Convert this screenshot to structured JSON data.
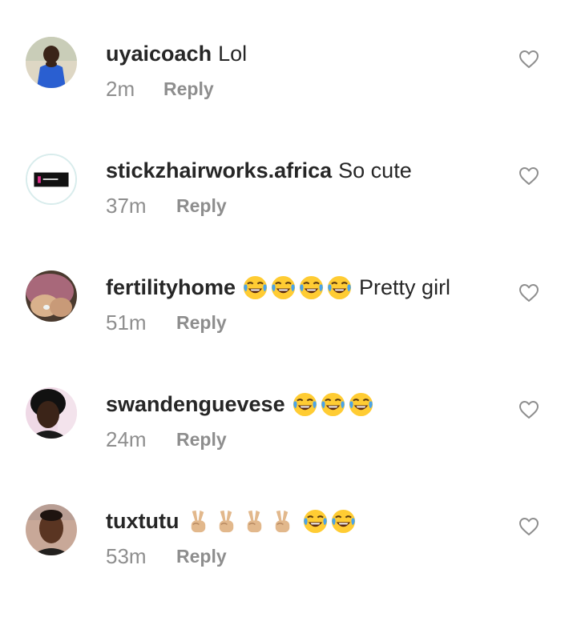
{
  "comments": [
    {
      "username": "uyaicoach",
      "text": "Lol",
      "emojis_before": [],
      "emojis_after": [],
      "time": "2m",
      "reply_label": "Reply",
      "avatar": "avatar-photo-blue-dress"
    },
    {
      "username": "stickzhairworks.africa",
      "text": "So cute",
      "emojis_before": [],
      "emojis_after": [],
      "time": "37m",
      "reply_label": "Reply",
      "avatar": "avatar-logo-stickz"
    },
    {
      "username": "fertilityhome",
      "text": "Pretty girl",
      "emojis_before": [
        "face-with-tears-of-joy",
        "face-with-tears-of-joy",
        "face-with-tears-of-joy",
        "face-with-tears-of-joy"
      ],
      "emojis_after": [],
      "time": "51m",
      "reply_label": "Reply",
      "avatar": "avatar-photo-pregnant-belly"
    },
    {
      "username": "swandenguevese",
      "text": "",
      "emojis_before": [
        "face-with-tears-of-joy",
        "face-with-tears-of-joy",
        "face-with-tears-of-joy"
      ],
      "emojis_after": [],
      "time": "24m",
      "reply_label": "Reply",
      "avatar": "avatar-photo-woman"
    },
    {
      "username": "tuxtutu",
      "text": "",
      "emojis_before": [
        "victory-hand",
        "victory-hand",
        "victory-hand",
        "victory-hand",
        "face-with-tears-of-joy",
        "face-with-tears-of-joy"
      ],
      "emojis_after": [],
      "time": "53m",
      "reply_label": "Reply",
      "avatar": "avatar-photo-man"
    }
  ],
  "like_icon": "heart-outline-icon",
  "colors": {
    "username": "#262626",
    "meta": "#8e8e8e",
    "heart": "#8e8e8e"
  }
}
